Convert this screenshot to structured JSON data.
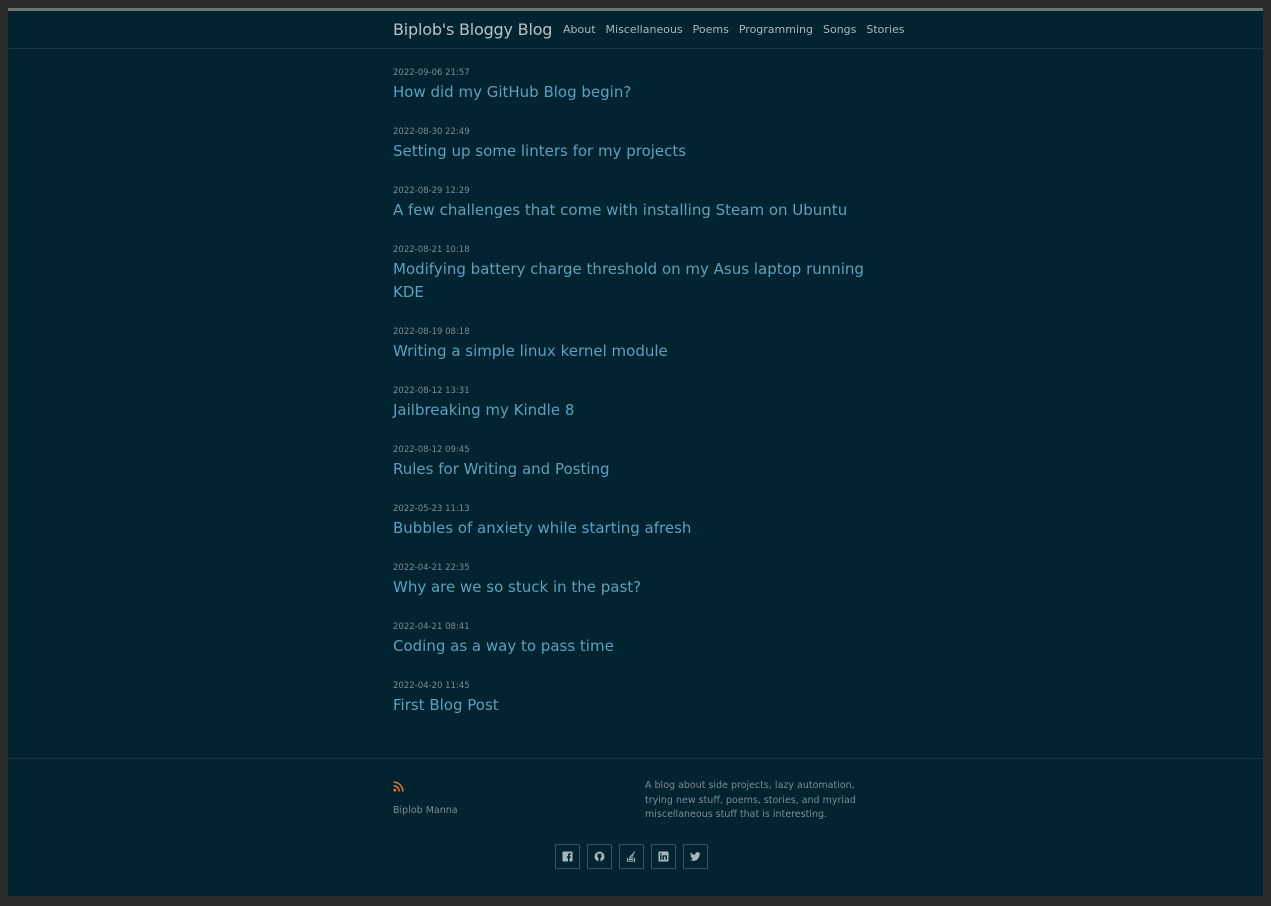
{
  "header": {
    "site_title": "Biplob's Bloggy Blog",
    "nav": [
      "About",
      "Miscellaneous",
      "Poems",
      "Programming",
      "Songs",
      "Stories"
    ]
  },
  "posts": [
    {
      "date": "2022-09-06 21:57",
      "title": "How did my GitHub Blog begin?"
    },
    {
      "date": "2022-08-30 22:49",
      "title": "Setting up some linters for my projects"
    },
    {
      "date": "2022-08-29 12:29",
      "title": "A few challenges that come with installing Steam on Ubuntu"
    },
    {
      "date": "2022-08-21 10:18",
      "title": "Modifying battery charge threshold on my Asus laptop running KDE"
    },
    {
      "date": "2022-08-19 08:18",
      "title": "Writing a simple linux kernel module"
    },
    {
      "date": "2022-08-12 13:31",
      "title": "Jailbreaking my Kindle 8"
    },
    {
      "date": "2022-08-12 09:45",
      "title": "Rules for Writing and Posting"
    },
    {
      "date": "2022-05-23 11:13",
      "title": "Bubbles of anxiety while starting afresh"
    },
    {
      "date": "2022-04-21 22:35",
      "title": "Why are we so stuck in the past?"
    },
    {
      "date": "2022-04-21 08:41",
      "title": "Coding as a way to pass time"
    },
    {
      "date": "2022-04-20 11:45",
      "title": "First Blog Post"
    }
  ],
  "footer": {
    "rss_icon": "rss-icon",
    "author": "Biplob Manna",
    "description": "A blog about side projects, lazy automation, trying new stuff, poems, stories, and myriad miscellaneous stuff that is interesting.",
    "socials": [
      "facebook-icon",
      "github-icon",
      "stackoverflow-icon",
      "linkedin-icon",
      "twitter-icon"
    ]
  },
  "colors": {
    "background": "#022430",
    "link": "#5f9fbd",
    "muted_text": "#7c8b90",
    "rss": "#e8742a"
  }
}
